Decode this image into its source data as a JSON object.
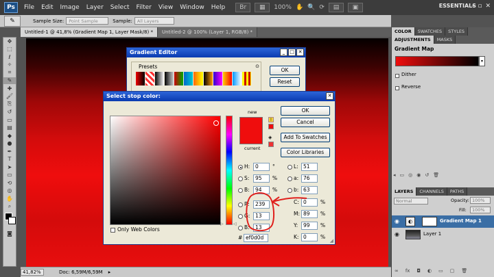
{
  "app": {
    "logo": "Ps",
    "menu": [
      "File",
      "Edit",
      "Image",
      "Layer",
      "Select",
      "Filter",
      "View",
      "Window",
      "Help"
    ],
    "workspace": "ESSENTIALS",
    "zoom_menu": "100%"
  },
  "options_bar": {
    "sample_size_label": "Sample Size:",
    "sample_size_value": "Point Sample",
    "sample_label": "Sample:",
    "sample_value": "All Layers"
  },
  "tabs": [
    {
      "label": "Untitled-1 @ 41,8% (Gradient Map 1, Layer Mask/8) *",
      "active": true
    },
    {
      "label": "Untitled-2 @ 100% (Layer 1, RGB/8) *",
      "active": false
    }
  ],
  "status": {
    "zoom": "41,82%",
    "doc": "Doc: 6,59M/6,59M"
  },
  "gradient_editor": {
    "title": "Gradient Editor",
    "presets_label": "Presets",
    "ok_label": "OK",
    "cancel_label": "Reset"
  },
  "stop_color": {
    "title": "Select stop color:",
    "new_label": "new",
    "current_label": "current",
    "ok_label": "OK",
    "cancel_label": "Cancel",
    "add_swatches_label": "Add To Swatches",
    "color_libraries_label": "Color Libraries",
    "only_web_colors_label": "Only Web Colors",
    "hsb": [
      {
        "key": "H:",
        "value": "0",
        "unit": "°",
        "selected": true
      },
      {
        "key": "S:",
        "value": "95",
        "unit": "%",
        "selected": false
      },
      {
        "key": "B:",
        "value": "94",
        "unit": "%",
        "selected": false
      }
    ],
    "rgb": [
      {
        "key": "R:",
        "value": "239"
      },
      {
        "key": "G:",
        "value": "13"
      },
      {
        "key": "B:",
        "value": "13"
      }
    ],
    "lab": [
      {
        "key": "L:",
        "value": "51"
      },
      {
        "key": "a:",
        "value": "76"
      },
      {
        "key": "b:",
        "value": "63"
      }
    ],
    "cmyk": [
      {
        "key": "C:",
        "value": "0",
        "unit": "%"
      },
      {
        "key": "M:",
        "value": "89",
        "unit": "%"
      },
      {
        "key": "Y:",
        "value": "99",
        "unit": "%"
      },
      {
        "key": "K:",
        "value": "0",
        "unit": "%"
      }
    ],
    "hex_label": "#",
    "hex_value": "ef0d0d"
  },
  "right_panels": {
    "color_tabs": [
      "COLOR",
      "SWATCHES",
      "STYLES"
    ],
    "adj_tabs": [
      "ADJUSTMENTS",
      "MASKS"
    ],
    "adj_title": "Gradient Map",
    "dither_label": "Dither",
    "reverse_label": "Reverse",
    "layer_tabs": [
      "LAYERS",
      "CHANNELS",
      "PATHS"
    ],
    "blend_mode": "Normal",
    "opacity_label": "Opacity:",
    "opacity_value": "100%",
    "fill_label": "Fill:",
    "fill_value": "100%",
    "layers": [
      {
        "name": "Gradient Map 1",
        "selected": true
      },
      {
        "name": "Layer 1",
        "selected": false
      }
    ]
  },
  "colors": {
    "picked": "#ef0d0d",
    "annotation": "#e0201c",
    "selection": "#3a6ea5"
  }
}
